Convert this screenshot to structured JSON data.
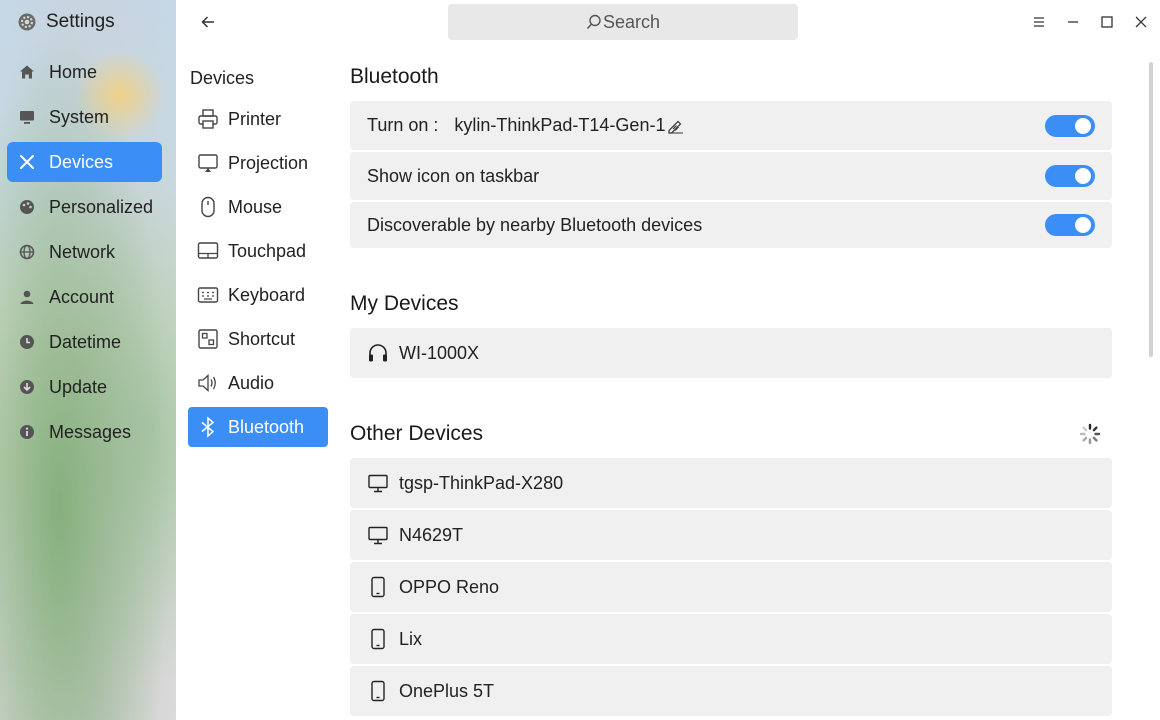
{
  "app": {
    "title": "Settings"
  },
  "nav": {
    "items": [
      {
        "label": "Home",
        "icon": "home-icon"
      },
      {
        "label": "System",
        "icon": "monitor-icon"
      },
      {
        "label": "Devices",
        "icon": "devices-icon",
        "active": true
      },
      {
        "label": "Personalized",
        "icon": "palette-icon"
      },
      {
        "label": "Network",
        "icon": "globe-icon"
      },
      {
        "label": "Account",
        "icon": "user-icon"
      },
      {
        "label": "Datetime",
        "icon": "clock-icon"
      },
      {
        "label": "Update",
        "icon": "update-icon"
      },
      {
        "label": "Messages",
        "icon": "info-icon"
      }
    ]
  },
  "search": {
    "label": "Search"
  },
  "subnav": {
    "title": "Devices",
    "items": [
      {
        "label": "Printer",
        "icon": "printer-icon"
      },
      {
        "label": "Projection",
        "icon": "projection-icon"
      },
      {
        "label": "Mouse",
        "icon": "mouse-icon"
      },
      {
        "label": "Touchpad",
        "icon": "touchpad-icon"
      },
      {
        "label": "Keyboard",
        "icon": "keyboard-icon"
      },
      {
        "label": "Shortcut",
        "icon": "shortcut-icon"
      },
      {
        "label": "Audio",
        "icon": "audio-icon"
      },
      {
        "label": "Bluetooth",
        "icon": "bluetooth-icon",
        "active": true
      }
    ]
  },
  "bluetooth": {
    "title": "Bluetooth",
    "turn_on_label": "Turn on :",
    "device_name": "kylin-ThinkPad-T14-Gen-1",
    "turn_on_enabled": true,
    "show_icon_label": "Show icon on taskbar",
    "show_icon_enabled": true,
    "discoverable_label": "Discoverable by nearby Bluetooth devices",
    "discoverable_enabled": true
  },
  "my_devices": {
    "title": "My Devices",
    "items": [
      {
        "name": "WI-1000X",
        "icon": "headphones-icon"
      }
    ]
  },
  "other_devices": {
    "title": "Other Devices",
    "items": [
      {
        "name": "tgsp-ThinkPad-X280",
        "icon": "computer-icon"
      },
      {
        "name": "N4629T",
        "icon": "computer-icon"
      },
      {
        "name": "OPPO Reno",
        "icon": "phone-icon"
      },
      {
        "name": "Lix",
        "icon": "phone-icon"
      },
      {
        "name": "OnePlus 5T",
        "icon": "phone-icon"
      }
    ]
  },
  "colors": {
    "accent": "#3b8ef5",
    "card": "#f0f0f0",
    "search": "#e8e8e8"
  }
}
